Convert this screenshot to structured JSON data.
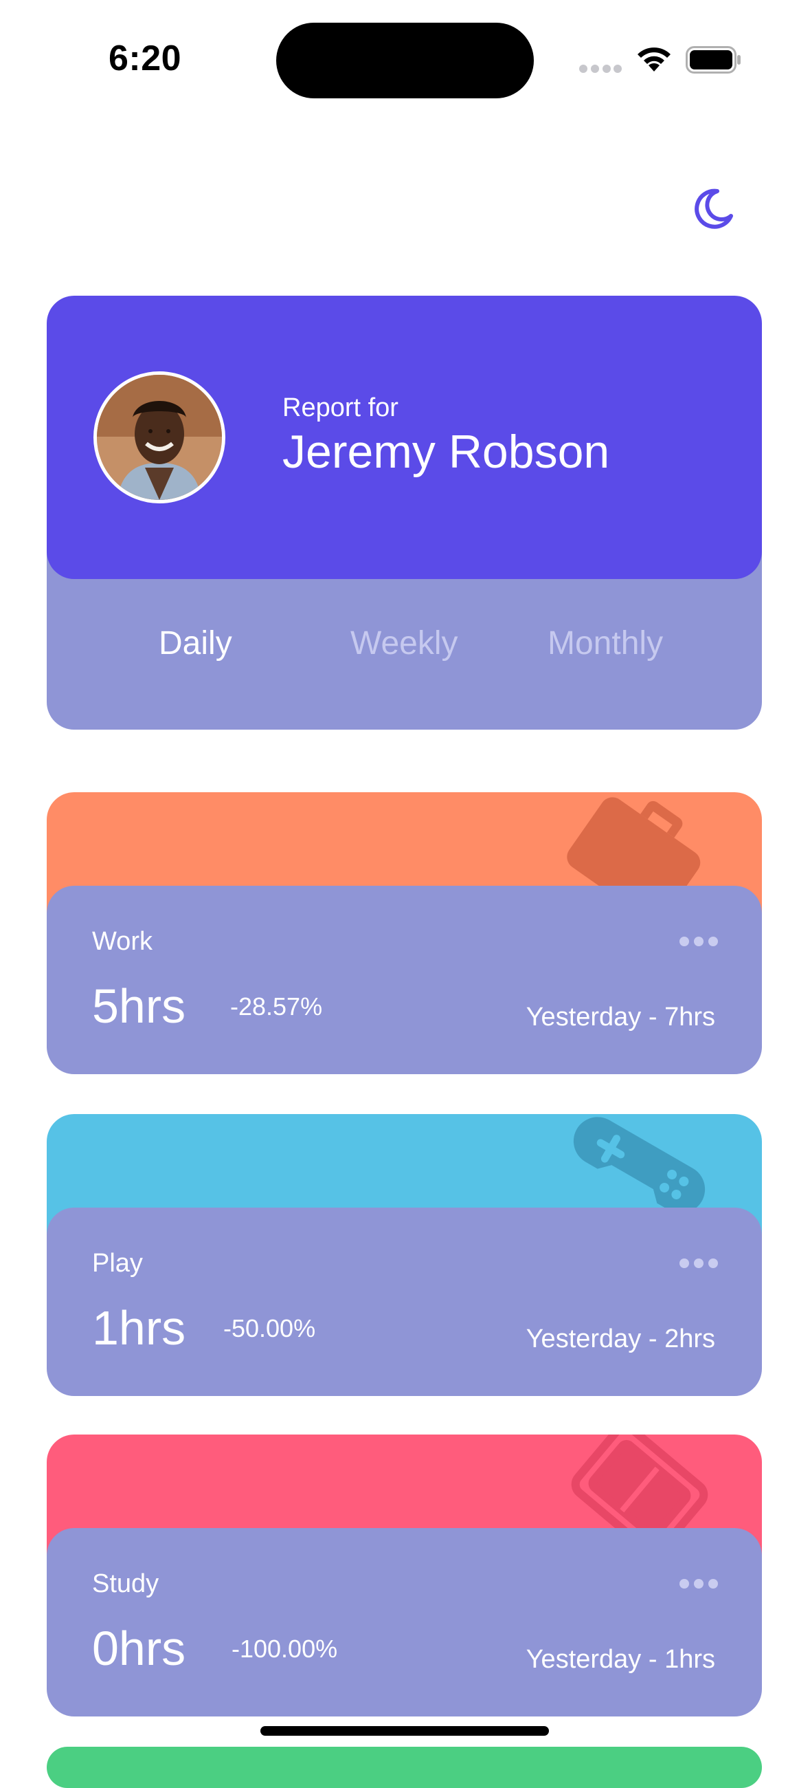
{
  "status_bar": {
    "time": "6:20"
  },
  "theme_toggle": {
    "icon": "moon-icon"
  },
  "profile": {
    "report_for": "Report for",
    "name": "Jeremy Robson",
    "card_color": "#5b4be8"
  },
  "periods": {
    "daily": "Daily",
    "weekly": "Weekly",
    "monthly": "Monthly",
    "selected": "Daily"
  },
  "activities": [
    {
      "label": "Work",
      "hours": "5hrs",
      "change": "-28.57%",
      "previous": "Yesterday - 7hrs",
      "color": "#ff8c66",
      "icon": "briefcase-icon"
    },
    {
      "label": "Play",
      "hours": "1hrs",
      "change": "-50.00%",
      "previous": "Yesterday - 2hrs",
      "color": "#56c2e6",
      "icon": "gamepad-icon"
    },
    {
      "label": "Study",
      "hours": "0hrs",
      "change": "-100.00%",
      "previous": "Yesterday - 1hrs",
      "color": "#ff5c7c",
      "icon": "book-icon"
    }
  ],
  "next_card_color": "#4bcf82"
}
